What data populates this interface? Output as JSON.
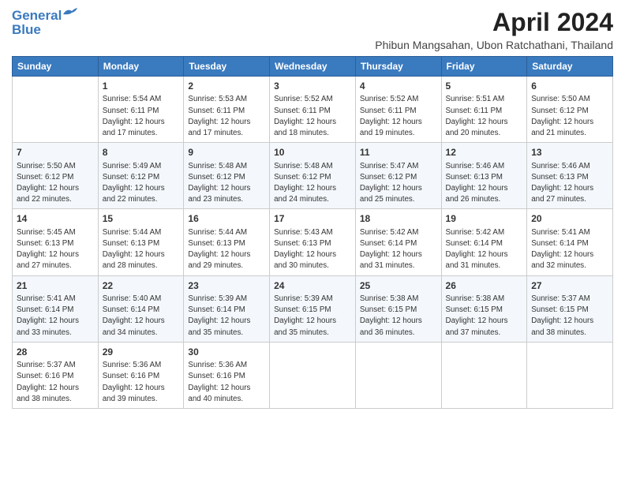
{
  "header": {
    "logo_line1": "General",
    "logo_line2": "Blue",
    "title": "April 2024",
    "subtitle": "Phibun Mangsahan, Ubon Ratchathani, Thailand"
  },
  "calendar": {
    "days_of_week": [
      "Sunday",
      "Monday",
      "Tuesday",
      "Wednesday",
      "Thursday",
      "Friday",
      "Saturday"
    ],
    "weeks": [
      [
        {
          "day": "",
          "info": ""
        },
        {
          "day": "1",
          "info": "Sunrise: 5:54 AM\nSunset: 6:11 PM\nDaylight: 12 hours\nand 17 minutes."
        },
        {
          "day": "2",
          "info": "Sunrise: 5:53 AM\nSunset: 6:11 PM\nDaylight: 12 hours\nand 17 minutes."
        },
        {
          "day": "3",
          "info": "Sunrise: 5:52 AM\nSunset: 6:11 PM\nDaylight: 12 hours\nand 18 minutes."
        },
        {
          "day": "4",
          "info": "Sunrise: 5:52 AM\nSunset: 6:11 PM\nDaylight: 12 hours\nand 19 minutes."
        },
        {
          "day": "5",
          "info": "Sunrise: 5:51 AM\nSunset: 6:11 PM\nDaylight: 12 hours\nand 20 minutes."
        },
        {
          "day": "6",
          "info": "Sunrise: 5:50 AM\nSunset: 6:12 PM\nDaylight: 12 hours\nand 21 minutes."
        }
      ],
      [
        {
          "day": "7",
          "info": "Sunrise: 5:50 AM\nSunset: 6:12 PM\nDaylight: 12 hours\nand 22 minutes."
        },
        {
          "day": "8",
          "info": "Sunrise: 5:49 AM\nSunset: 6:12 PM\nDaylight: 12 hours\nand 22 minutes."
        },
        {
          "day": "9",
          "info": "Sunrise: 5:48 AM\nSunset: 6:12 PM\nDaylight: 12 hours\nand 23 minutes."
        },
        {
          "day": "10",
          "info": "Sunrise: 5:48 AM\nSunset: 6:12 PM\nDaylight: 12 hours\nand 24 minutes."
        },
        {
          "day": "11",
          "info": "Sunrise: 5:47 AM\nSunset: 6:12 PM\nDaylight: 12 hours\nand 25 minutes."
        },
        {
          "day": "12",
          "info": "Sunrise: 5:46 AM\nSunset: 6:13 PM\nDaylight: 12 hours\nand 26 minutes."
        },
        {
          "day": "13",
          "info": "Sunrise: 5:46 AM\nSunset: 6:13 PM\nDaylight: 12 hours\nand 27 minutes."
        }
      ],
      [
        {
          "day": "14",
          "info": "Sunrise: 5:45 AM\nSunset: 6:13 PM\nDaylight: 12 hours\nand 27 minutes."
        },
        {
          "day": "15",
          "info": "Sunrise: 5:44 AM\nSunset: 6:13 PM\nDaylight: 12 hours\nand 28 minutes."
        },
        {
          "day": "16",
          "info": "Sunrise: 5:44 AM\nSunset: 6:13 PM\nDaylight: 12 hours\nand 29 minutes."
        },
        {
          "day": "17",
          "info": "Sunrise: 5:43 AM\nSunset: 6:13 PM\nDaylight: 12 hours\nand 30 minutes."
        },
        {
          "day": "18",
          "info": "Sunrise: 5:42 AM\nSunset: 6:14 PM\nDaylight: 12 hours\nand 31 minutes."
        },
        {
          "day": "19",
          "info": "Sunrise: 5:42 AM\nSunset: 6:14 PM\nDaylight: 12 hours\nand 31 minutes."
        },
        {
          "day": "20",
          "info": "Sunrise: 5:41 AM\nSunset: 6:14 PM\nDaylight: 12 hours\nand 32 minutes."
        }
      ],
      [
        {
          "day": "21",
          "info": "Sunrise: 5:41 AM\nSunset: 6:14 PM\nDaylight: 12 hours\nand 33 minutes."
        },
        {
          "day": "22",
          "info": "Sunrise: 5:40 AM\nSunset: 6:14 PM\nDaylight: 12 hours\nand 34 minutes."
        },
        {
          "day": "23",
          "info": "Sunrise: 5:39 AM\nSunset: 6:14 PM\nDaylight: 12 hours\nand 35 minutes."
        },
        {
          "day": "24",
          "info": "Sunrise: 5:39 AM\nSunset: 6:15 PM\nDaylight: 12 hours\nand 35 minutes."
        },
        {
          "day": "25",
          "info": "Sunrise: 5:38 AM\nSunset: 6:15 PM\nDaylight: 12 hours\nand 36 minutes."
        },
        {
          "day": "26",
          "info": "Sunrise: 5:38 AM\nSunset: 6:15 PM\nDaylight: 12 hours\nand 37 minutes."
        },
        {
          "day": "27",
          "info": "Sunrise: 5:37 AM\nSunset: 6:15 PM\nDaylight: 12 hours\nand 38 minutes."
        }
      ],
      [
        {
          "day": "28",
          "info": "Sunrise: 5:37 AM\nSunset: 6:16 PM\nDaylight: 12 hours\nand 38 minutes."
        },
        {
          "day": "29",
          "info": "Sunrise: 5:36 AM\nSunset: 6:16 PM\nDaylight: 12 hours\nand 39 minutes."
        },
        {
          "day": "30",
          "info": "Sunrise: 5:36 AM\nSunset: 6:16 PM\nDaylight: 12 hours\nand 40 minutes."
        },
        {
          "day": "",
          "info": ""
        },
        {
          "day": "",
          "info": ""
        },
        {
          "day": "",
          "info": ""
        },
        {
          "day": "",
          "info": ""
        }
      ]
    ]
  }
}
